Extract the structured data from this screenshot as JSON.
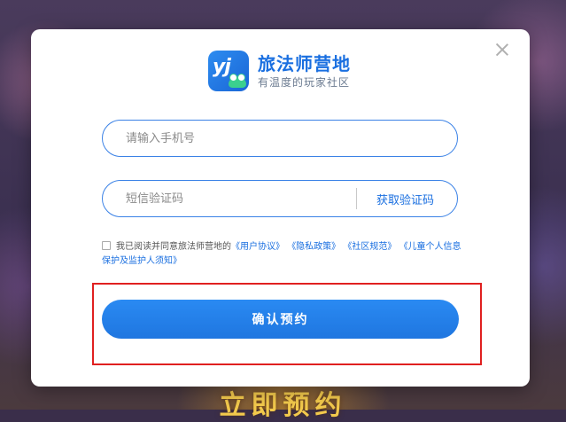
{
  "background": {
    "bottom_text": "立即预约"
  },
  "modal": {
    "brand": {
      "logo_text": "yj",
      "name": "旅法师营地",
      "slogan": "有温度的玩家社区"
    },
    "phone_input": {
      "placeholder": "请输入手机号",
      "value": ""
    },
    "sms_input": {
      "placeholder": "短信验证码",
      "value": ""
    },
    "get_code_label": "获取验证码",
    "agreement": {
      "checked": false,
      "prefix": "我已阅读并同意旅法师营地的",
      "links": [
        "《用户协议》",
        "《隐私政策》",
        "《社区规范》",
        "《儿童个人信息保护及监护人须知》"
      ]
    },
    "confirm_label": "确认预约"
  },
  "colors": {
    "accent": "#1a6fe0",
    "button": "#2a8af2",
    "highlight_box": "#e02020"
  }
}
